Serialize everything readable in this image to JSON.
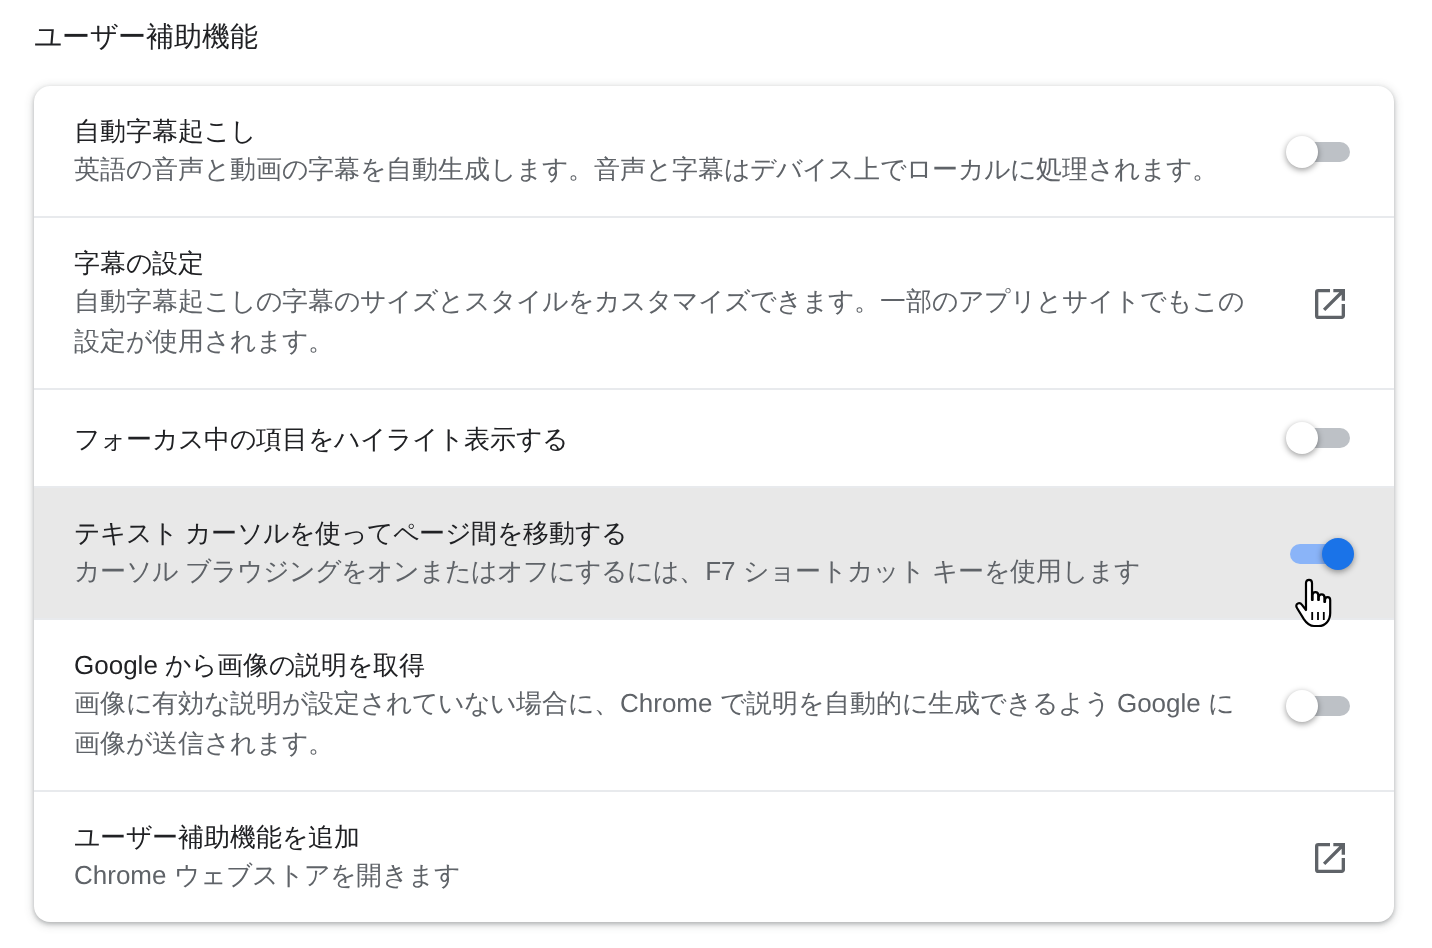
{
  "section_title": "ユーザー補助機能",
  "rows": [
    {
      "kind": "toggle",
      "title": "自動字幕起こし",
      "description": "英語の音声と動画の字幕を自動生成します。音声と字幕はデバイス上でローカルに処理されます。",
      "on": false,
      "highlighted": false
    },
    {
      "kind": "link",
      "title": "字幕の設定",
      "description": "自動字幕起こしの字幕のサイズとスタイルをカスタマイズできます。一部のアプリとサイトでもこの設定が使用されます。",
      "highlighted": false
    },
    {
      "kind": "toggle",
      "title": "フォーカス中の項目をハイライト表示する",
      "on": false,
      "highlighted": false
    },
    {
      "kind": "toggle",
      "title": "テキスト カーソルを使ってページ間を移動する",
      "description": "カーソル ブラウジングをオンまたはオフにするには、F7 ショートカット キーを使用します",
      "on": true,
      "highlighted": true
    },
    {
      "kind": "toggle",
      "title": "Google から画像の説明を取得",
      "description": "画像に有効な説明が設定されていない場合に、Chrome で説明を自動的に生成できるよう Google に画像が送信されます。",
      "on": false,
      "highlighted": false
    },
    {
      "kind": "link",
      "title": "ユーザー補助機能を追加",
      "description": "Chrome ウェブストアを開きます",
      "highlighted": false
    }
  ]
}
